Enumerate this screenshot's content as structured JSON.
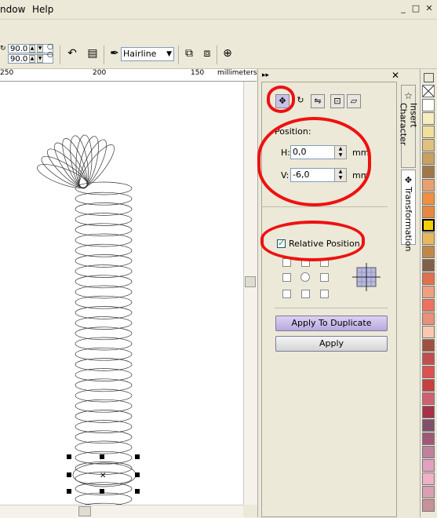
{
  "menu": {
    "window_partial": "ndow",
    "help": "Help"
  },
  "window_controls": [
    "_",
    "□",
    "✕"
  ],
  "toolbar": {
    "angle_top": "90.0",
    "angle_bottom": "90.0",
    "outline_width": "Hairline",
    "outline_dropdown_arrow": "▼"
  },
  "ruler": {
    "labels": [
      "250",
      "200",
      "150"
    ],
    "units": "millimeters"
  },
  "docker": {
    "header_arrows": "▸▸",
    "close": "✕",
    "position_heading": "Position:",
    "h_label": "H:",
    "h_value": "0,0",
    "h_unit": "mm",
    "v_label": "V:",
    "v_value": "-6,0",
    "v_unit": "mm",
    "relative_position_label": "Relative Position",
    "relative_position_checked": true,
    "apply_to_duplicate": "Apply To Duplicate",
    "apply": "Apply",
    "tabs": [
      "Insert Character",
      "Transformation"
    ]
  },
  "palette_colors": [
    "#ffffff",
    "#f5efc0",
    "#f0e09a",
    "#e0c080",
    "#c8a060",
    "#a07848",
    "#e8a070",
    "#f09040",
    "#e88840",
    "#f0d000",
    "#e8b860",
    "#c08848",
    "#806048",
    "#e07050",
    "#f0a080",
    "#f07060",
    "#e89078",
    "#f8c8b0",
    "#a05040",
    "#c05050",
    "#e05050",
    "#c84040",
    "#d06070",
    "#a83048",
    "#805068",
    "#a05878",
    "#c080a0",
    "#e0a0c0",
    "#f0b0c8",
    "#d8a0b0",
    "#c89098"
  ],
  "colors": {
    "annotation_ring": "#ee1111",
    "apply_dup_bg": "#c8b8e8"
  }
}
